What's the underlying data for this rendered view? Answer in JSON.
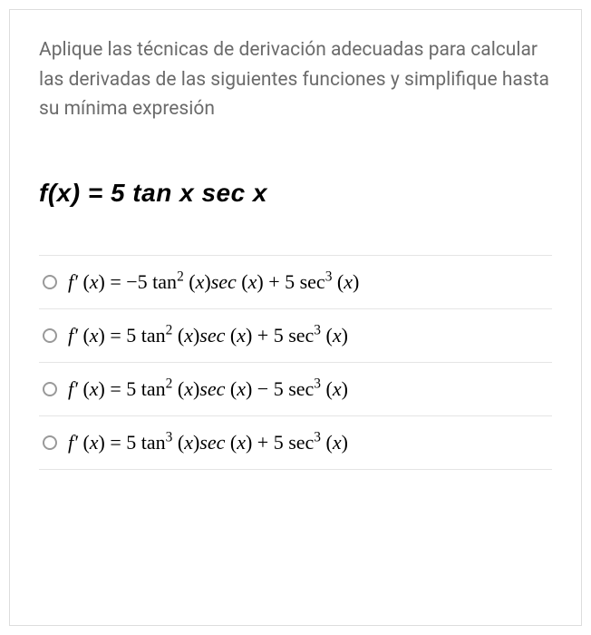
{
  "question_text": "Aplique las técnicas de derivación adecuadas para calcular las derivadas de las siguientes funciones y simplifique hasta su mínima expresión",
  "main_formula": "f(x) = 5 tan x sec x",
  "options": [
    {
      "prefix": "f′ (x) = ",
      "expr": "−5 tan² (x) sec (x) + 5 sec³ (x)"
    },
    {
      "prefix": "f′ (x) = ",
      "expr": "5 tan² (x) sec (x) + 5 sec³ (x)"
    },
    {
      "prefix": "f′ (x) = ",
      "expr": "5 tan² (x) sec (x) − 5 sec³ (x)"
    },
    {
      "prefix": "f′ (x) = ",
      "expr": "5 tan³ (x) sec (x) + 5 sec³ (x)"
    }
  ]
}
